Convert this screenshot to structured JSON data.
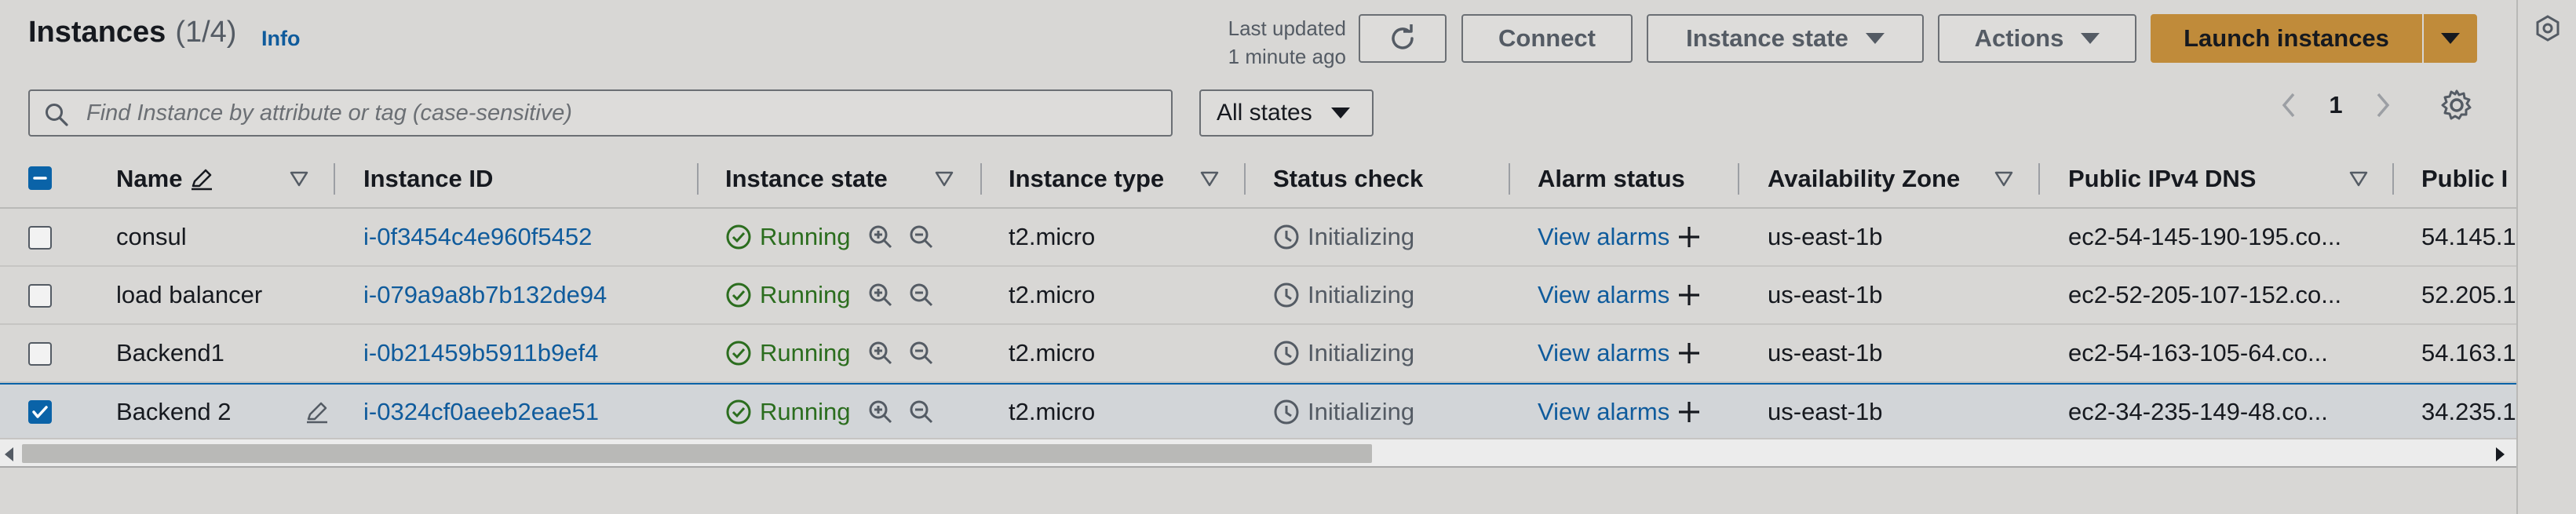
{
  "header": {
    "title": "Instances",
    "count": "(1/4)",
    "info_link": "Info",
    "last_updated_line1": "Last updated",
    "last_updated_line2": "1 minute ago"
  },
  "toolbar": {
    "refresh_icon": "refresh-icon",
    "connect_label": "Connect",
    "instance_state_label": "Instance state",
    "actions_label": "Actions",
    "launch_label": "Launch instances"
  },
  "filter": {
    "search_placeholder": "Find Instance by attribute or tag (case-sensitive)",
    "states_selected": "All states"
  },
  "pagination": {
    "current_page": "1"
  },
  "table": {
    "columns": [
      {
        "label": "Name"
      },
      {
        "label": "Instance ID"
      },
      {
        "label": "Instance state"
      },
      {
        "label": "Instance type"
      },
      {
        "label": "Status check"
      },
      {
        "label": "Alarm status"
      },
      {
        "label": "Availability Zone"
      },
      {
        "label": "Public IPv4 DNS"
      },
      {
        "label": "Public I"
      }
    ],
    "rows": [
      {
        "name": "consul",
        "id": "i-0f3454c4e960f5452",
        "state": "Running",
        "type": "t2.micro",
        "status": "Initializing",
        "alarm": "View alarms",
        "az": "us-east-1b",
        "dns": "ec2-54-145-190-195.co...",
        "ip": "54.145.1",
        "selected": false
      },
      {
        "name": "load balancer",
        "id": "i-079a9a8b7b132de94",
        "state": "Running",
        "type": "t2.micro",
        "status": "Initializing",
        "alarm": "View alarms",
        "az": "us-east-1b",
        "dns": "ec2-52-205-107-152.co...",
        "ip": "52.205.1",
        "selected": false
      },
      {
        "name": "Backend1",
        "id": "i-0b21459b5911b9ef4",
        "state": "Running",
        "type": "t2.micro",
        "status": "Initializing",
        "alarm": "View alarms",
        "az": "us-east-1b",
        "dns": "ec2-54-163-105-64.co...",
        "ip": "54.163.1",
        "selected": false
      },
      {
        "name": "Backend 2",
        "id": "i-0324cf0aeeb2eae51",
        "state": "Running",
        "type": "t2.micro",
        "status": "Initializing",
        "alarm": "View alarms",
        "az": "us-east-1b",
        "dns": "ec2-34-235-149-48.co...",
        "ip": "34.235.1",
        "selected": true
      }
    ]
  },
  "colors": {
    "accent_link": "#0f5b9c",
    "running_green": "#2b6d1e",
    "primary_button": "#c08b3a",
    "selected_border": "#0a63a8"
  }
}
